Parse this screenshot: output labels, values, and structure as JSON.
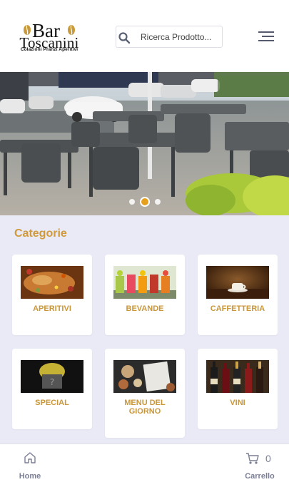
{
  "header": {
    "logo": {
      "title": "Bar",
      "name": "Toscanini",
      "tagline": "Colazioni Pranzi Aperitivi"
    },
    "search": {
      "placeholder": "Ricerca Prodotto..."
    },
    "menu_icon": "hamburger-menu-icon"
  },
  "hero": {
    "slide_count": 3,
    "active_slide": 2
  },
  "categories": {
    "title": "Categorie",
    "items": [
      {
        "label": "APERITIVI"
      },
      {
        "label": "BEVANDE"
      },
      {
        "label": "CAFFETTERIA"
      },
      {
        "label": "SPECIAL"
      },
      {
        "label": "MENU DEL GIORNO"
      },
      {
        "label": "VINI"
      }
    ]
  },
  "bottom_nav": {
    "home": {
      "label": "Home",
      "icon": "home-icon"
    },
    "cart": {
      "label": "Carrello",
      "icon": "cart-icon",
      "count": "0"
    }
  },
  "colors": {
    "accent": "#d09a3c",
    "background": "#e9eaf6",
    "nav_text": "#7b7f95",
    "active_dot": "#e6a01d"
  }
}
